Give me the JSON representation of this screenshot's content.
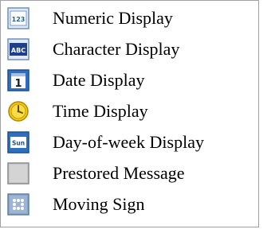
{
  "menu": {
    "items": [
      {
        "label": "Numeric Display",
        "icon": "numeric-icon",
        "icon_text": "123"
      },
      {
        "label": "Character Display",
        "icon": "character-icon",
        "icon_text": "ABC"
      },
      {
        "label": "Date Display",
        "icon": "date-icon",
        "icon_text": "1"
      },
      {
        "label": "Time Display",
        "icon": "clock-icon"
      },
      {
        "label": "Day-of-week Display",
        "icon": "day-of-week-icon",
        "icon_text": "Sun"
      },
      {
        "label": "Prestored Message",
        "icon": "message-icon"
      },
      {
        "label": "Moving Sign",
        "icon": "moving-sign-icon"
      }
    ]
  },
  "colors": {
    "icon_bg_blue": "#3a78c8",
    "icon_border": "#6f8fb8",
    "clock_yellow": "#f2cc10",
    "message_gray": "#c8c8c8",
    "menu_border": "#a0a0a0"
  }
}
